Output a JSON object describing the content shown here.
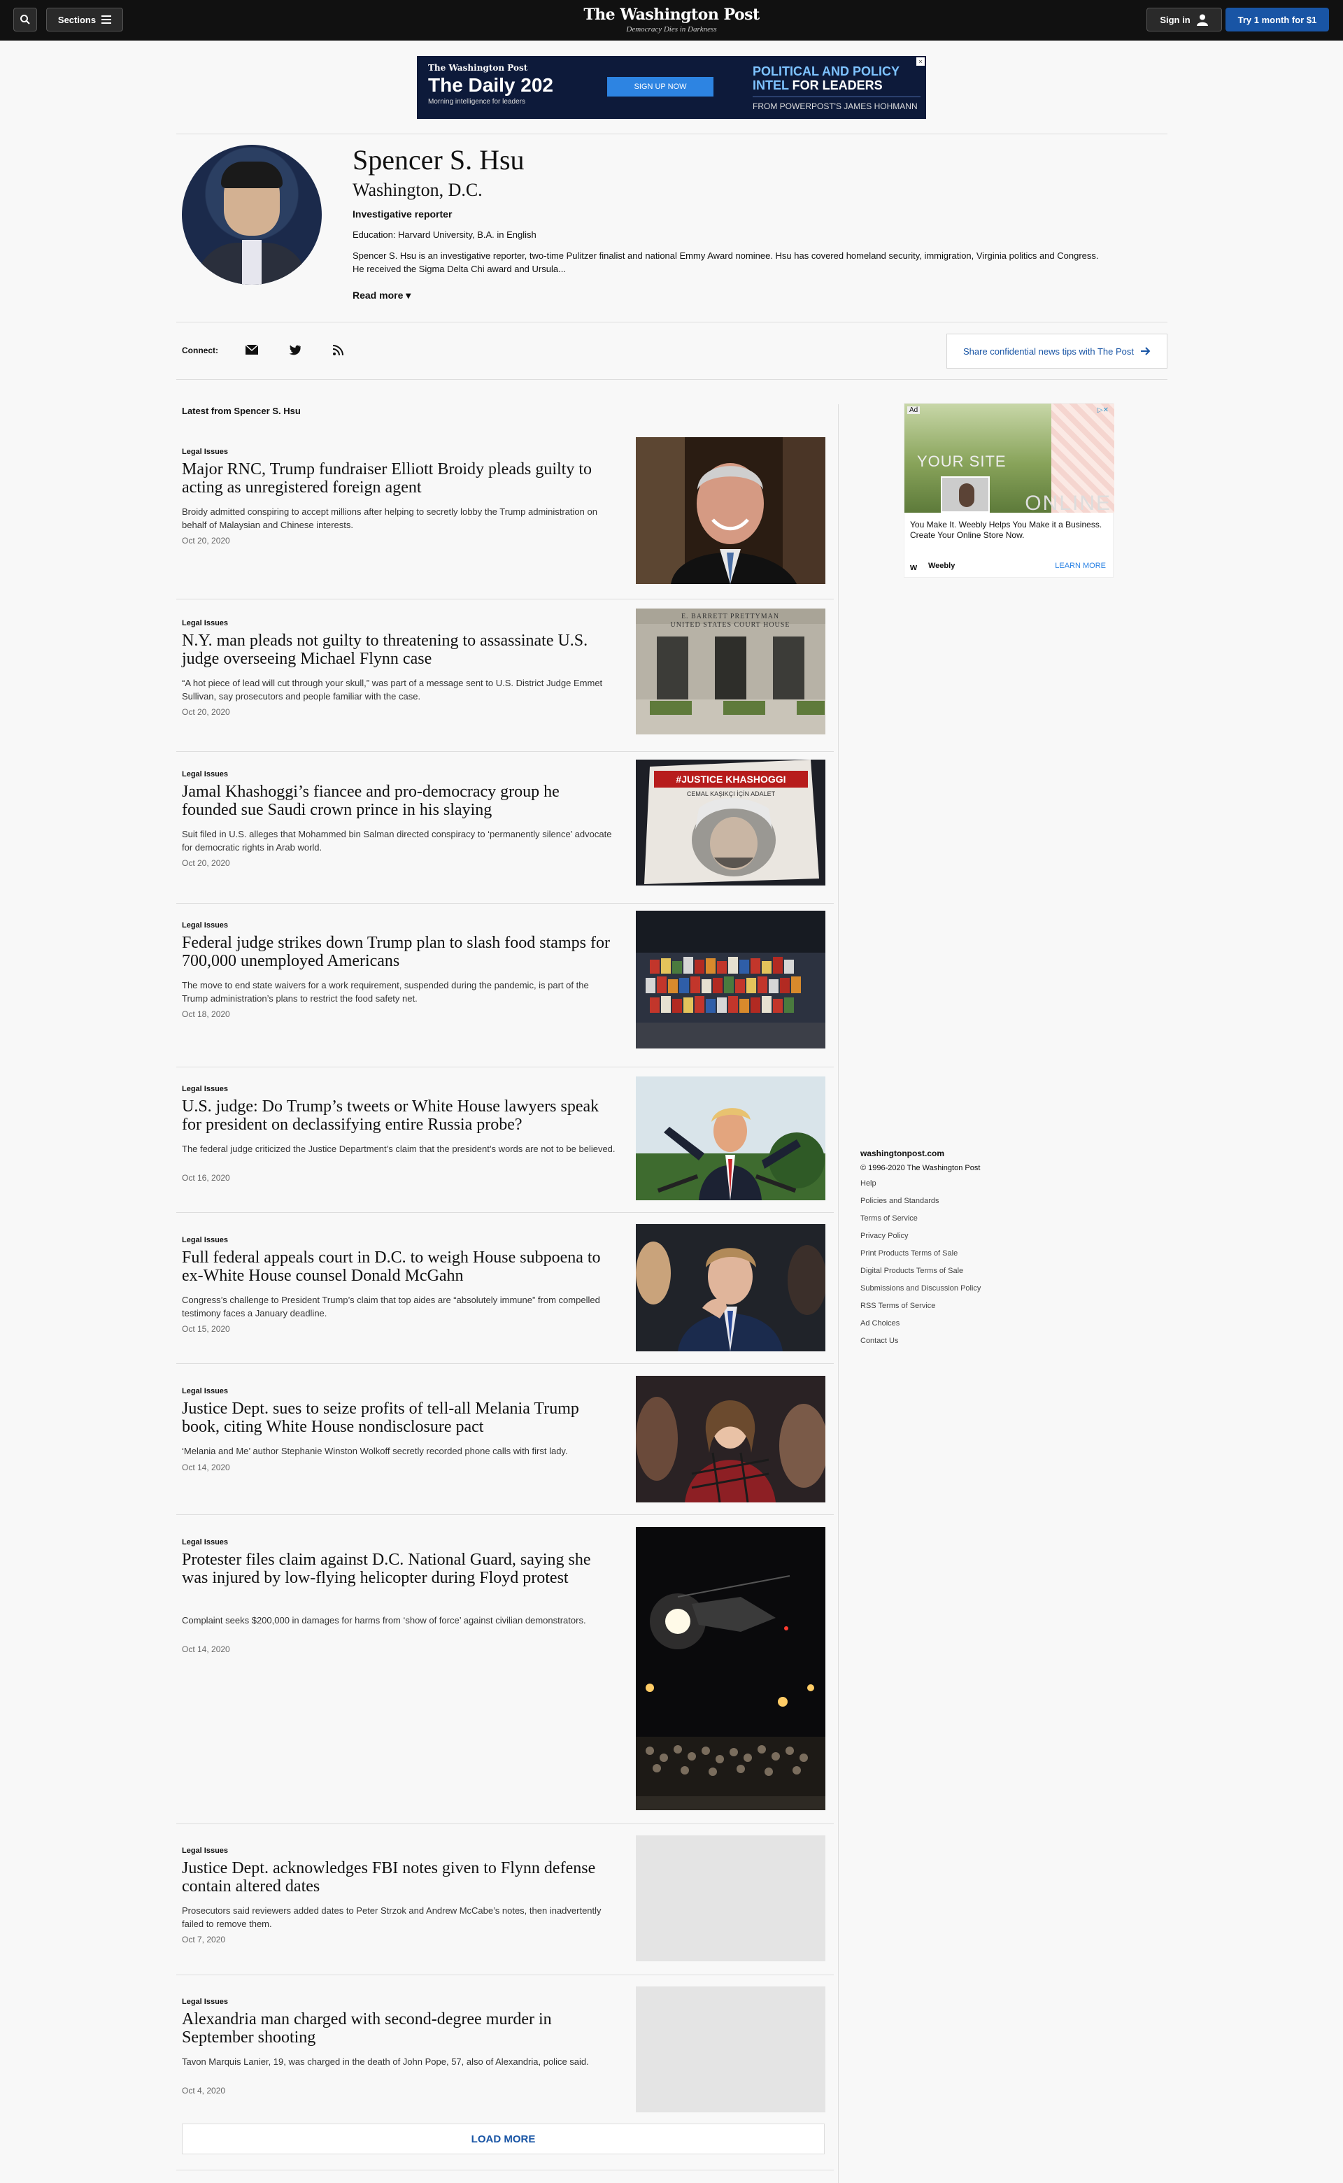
{
  "header": {
    "sections_label": "Sections",
    "logo": "The Washington Post",
    "tagline": "Democracy Dies in Darkness",
    "signin_label": "Sign in",
    "try_label": "Try 1 month for $1"
  },
  "top_ad": {
    "brand": "The Washington Post",
    "title": "The Daily 202",
    "subtitle": "Morning intelligence for leaders",
    "cta": "SIGN UP NOW",
    "right_line1": "POLITICAL AND POLICY",
    "right_line2_accent": "INTEL",
    "right_line2_rest": " FOR LEADERS",
    "right_line3": "FROM POWERPOST'S JAMES HOHMANN"
  },
  "author": {
    "name": "Spencer S. Hsu",
    "location": "Washington, D.C.",
    "role": "Investigative reporter",
    "education": "Education: Harvard University, B.A. in English",
    "bio": "Spencer S. Hsu is an investigative reporter, two-time Pulitzer finalist and national Emmy Award nominee. Hsu has covered homeland security, immigration, Virginia politics and Congress. He received the Sigma Delta Chi award and Ursula...",
    "read_more": "Read more"
  },
  "connect": {
    "label": "Connect:",
    "tips_label": "Share confidential news tips with The Post"
  },
  "latest_title": "Latest from Spencer S. Hsu",
  "articles": [
    {
      "kicker": "Legal Issues",
      "headline": "Major RNC, Trump fundraiser Elliott Broidy pleads guilty to acting as unregistered foreign agent",
      "blurb": "Broidy admitted conspiring to accept millions after helping to secretly lobby the Trump administration on behalf of Malaysian and Chinese interests.",
      "date": "Oct 20, 2020"
    },
    {
      "kicker": "Legal Issues",
      "headline": "N.Y. man pleads not guilty to threatening to assassinate U.S. judge overseeing Michael Flynn case",
      "blurb": "“A hot piece of lead will cut through your skull,” was part of a message sent to U.S. District Judge Emmet Sullivan, say prosecutors and people familiar with the case.",
      "date": "Oct 20, 2020",
      "image_text": "E. BARRETT PRETTYMAN UNITED STATES COURT HOUSE"
    },
    {
      "kicker": "Legal Issues",
      "headline": "Jamal Khashoggi’s fiancee and pro-democracy group he founded sue Saudi crown prince in his slaying",
      "blurb": "Suit filed in U.S. alleges that Mohammed bin Salman directed conspiracy to ‘permanently silence’ advocate for democratic rights in Arab world.",
      "date": "Oct 20, 2020",
      "image_text": "#JUSTICE KHASHOGGI",
      "image_text2": "CEMAL KAŞIKÇI İÇİN ADALET"
    },
    {
      "kicker": "Legal Issues",
      "headline": "Federal judge strikes down Trump plan to slash food stamps for 700,000 unemployed Americans",
      "blurb": "The move to end state waivers for a work requirement, suspended during the pandemic, is part of the Trump administration’s plans to restrict the food safety net.",
      "date": "Oct 18, 2020"
    },
    {
      "kicker": "Legal Issues",
      "headline": "U.S. judge: Do Trump’s tweets or White House lawyers speak for president on declassifying entire Russia probe?",
      "blurb": "The federal judge criticized the Justice Department’s claim that the president’s words are not to be believed.",
      "date": "Oct 16, 2020"
    },
    {
      "kicker": "Legal Issues",
      "headline": "Full federal appeals court in D.C. to weigh House subpoena to ex-White House counsel Donald McGahn",
      "blurb": "Congress’s challenge to President Trump’s claim that top aides are “absolutely immune” from compelled testimony faces a January deadline.",
      "date": "Oct 15, 2020"
    },
    {
      "kicker": "Legal Issues",
      "headline": "Justice Dept. sues to seize profits of tell-all Melania Trump book, citing White House nondisclosure pact",
      "blurb": "‘Melania and Me’ author Stephanie Winston Wolkoff secretly recorded phone calls with first lady.",
      "date": "Oct 14, 2020"
    },
    {
      "kicker": "Legal Issues",
      "headline": "Protester files claim against D.C. National Guard, saying she was injured by low-flying helicopter during Floyd protest",
      "blurb": "Complaint seeks $200,000 in damages for harms from ‘show of force’ against civilian demonstrators.",
      "date": "Oct 14, 2020"
    },
    {
      "kicker": "Legal Issues",
      "headline": "Justice Dept. acknowledges FBI notes given to Flynn defense contain altered dates",
      "blurb": "Prosecutors said reviewers added dates to Peter Strzok and Andrew McCabe’s notes, then inadvertently failed to remove them.",
      "date": "Oct 7, 2020"
    },
    {
      "kicker": "Legal Issues",
      "headline": "Alexandria man charged with second-degree murder in September shooting",
      "blurb": "Tavon Marquis Lanier, 19, was charged in the death of John Pope, 57, also of Alexandria, police said.",
      "date": "Oct 4, 2020"
    }
  ],
  "load_more": "LOAD MORE",
  "side_ad": {
    "ad_tag": "Ad",
    "image_text1": "YOUR SITE",
    "image_text2": "ONLINE",
    "copy": "You Make It. Weebly Helps You Make it a Business. Create Your Online Store Now.",
    "brand": "Weebly",
    "cta": "LEARN MORE"
  },
  "footer": {
    "site": "washingtonpost.com",
    "copyright": "© 1996-2020 The Washington Post",
    "links": [
      "Help",
      "Policies and Standards",
      "Terms of Service",
      "Privacy Policy",
      "Print Products Terms of Sale",
      "Digital Products Terms of Sale",
      "Submissions and Discussion Policy",
      "RSS Terms of Service",
      "Ad Choices",
      "Contact Us"
    ]
  },
  "colors": {
    "accent": "#1955a5",
    "header_bg": "#111111",
    "page_bg": "#f8f8f8"
  }
}
